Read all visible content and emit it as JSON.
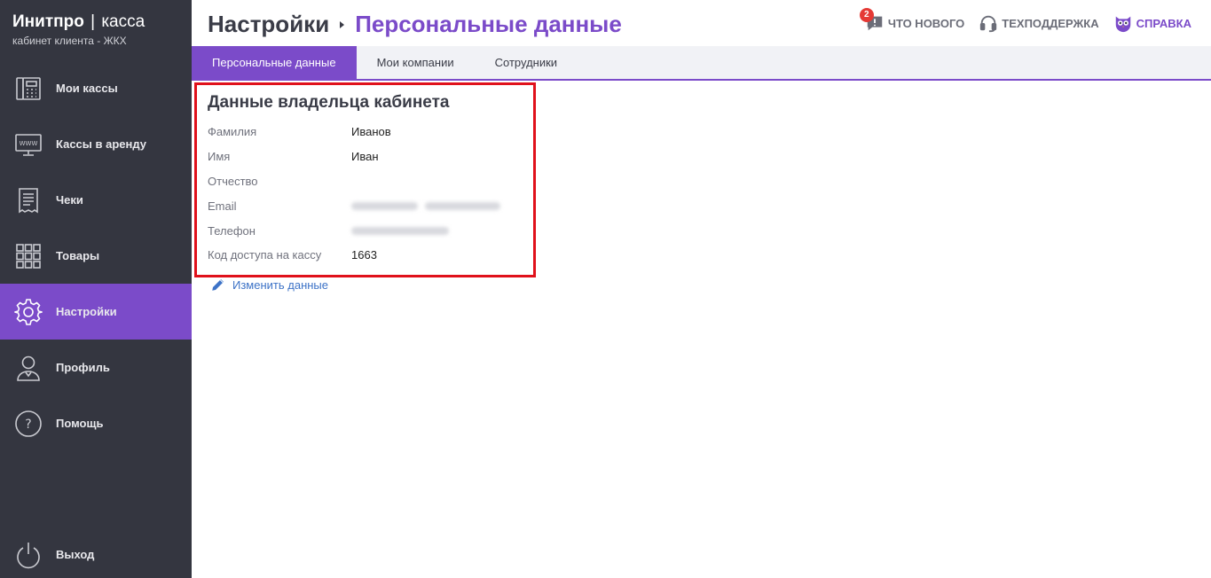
{
  "brand": {
    "name": "Инитпро",
    "separator": "|",
    "product": "касса",
    "subtitle": "кабинет клиента - ЖКХ"
  },
  "sidebar": {
    "items": [
      {
        "label": "Мои кассы",
        "icon": "cash-register-icon"
      },
      {
        "label": "Кассы в аренду",
        "icon": "www-monitor-icon"
      },
      {
        "label": "Чеки",
        "icon": "receipt-icon"
      },
      {
        "label": "Товары",
        "icon": "grid-icon"
      },
      {
        "label": "Настройки",
        "icon": "gear-icon",
        "active": true
      },
      {
        "label": "Профиль",
        "icon": "user-icon"
      },
      {
        "label": "Помощь",
        "icon": "question-icon"
      },
      {
        "label": "Выход",
        "icon": "power-icon"
      }
    ]
  },
  "header": {
    "breadcrumb_parent": "Настройки",
    "breadcrumb_current": "Персональные данные",
    "whats_new": {
      "label": "ЧТО НОВОГО",
      "badge": "2",
      "icon": "chat-icon"
    },
    "support": {
      "label": "ТЕХПОДДЕРЖКА",
      "icon": "headset-icon"
    },
    "help": {
      "label": "СПРАВКА",
      "icon": "owl-icon"
    }
  },
  "tabs": [
    {
      "label": "Персональные данные",
      "active": true
    },
    {
      "label": "Мои компании"
    },
    {
      "label": "Сотрудники"
    }
  ],
  "owner": {
    "title": "Данные владельца кабинета",
    "fields": [
      {
        "label": "Фамилия",
        "value": "Иванов"
      },
      {
        "label": "Имя",
        "value": "Иван"
      },
      {
        "label": "Отчество",
        "value": ""
      },
      {
        "label": "Email",
        "value": "",
        "blurred": true
      },
      {
        "label": "Телефон",
        "value": "",
        "blurred": true
      },
      {
        "label": "Код доступа на кассу",
        "value": "1663"
      }
    ]
  },
  "edit_link": {
    "label": "Изменить данные",
    "icon": "pencil-icon"
  },
  "colors": {
    "sidebar_bg": "#343640",
    "accent": "#7b4bc9",
    "highlight_border": "#e0111b",
    "link": "#3d73c7"
  }
}
